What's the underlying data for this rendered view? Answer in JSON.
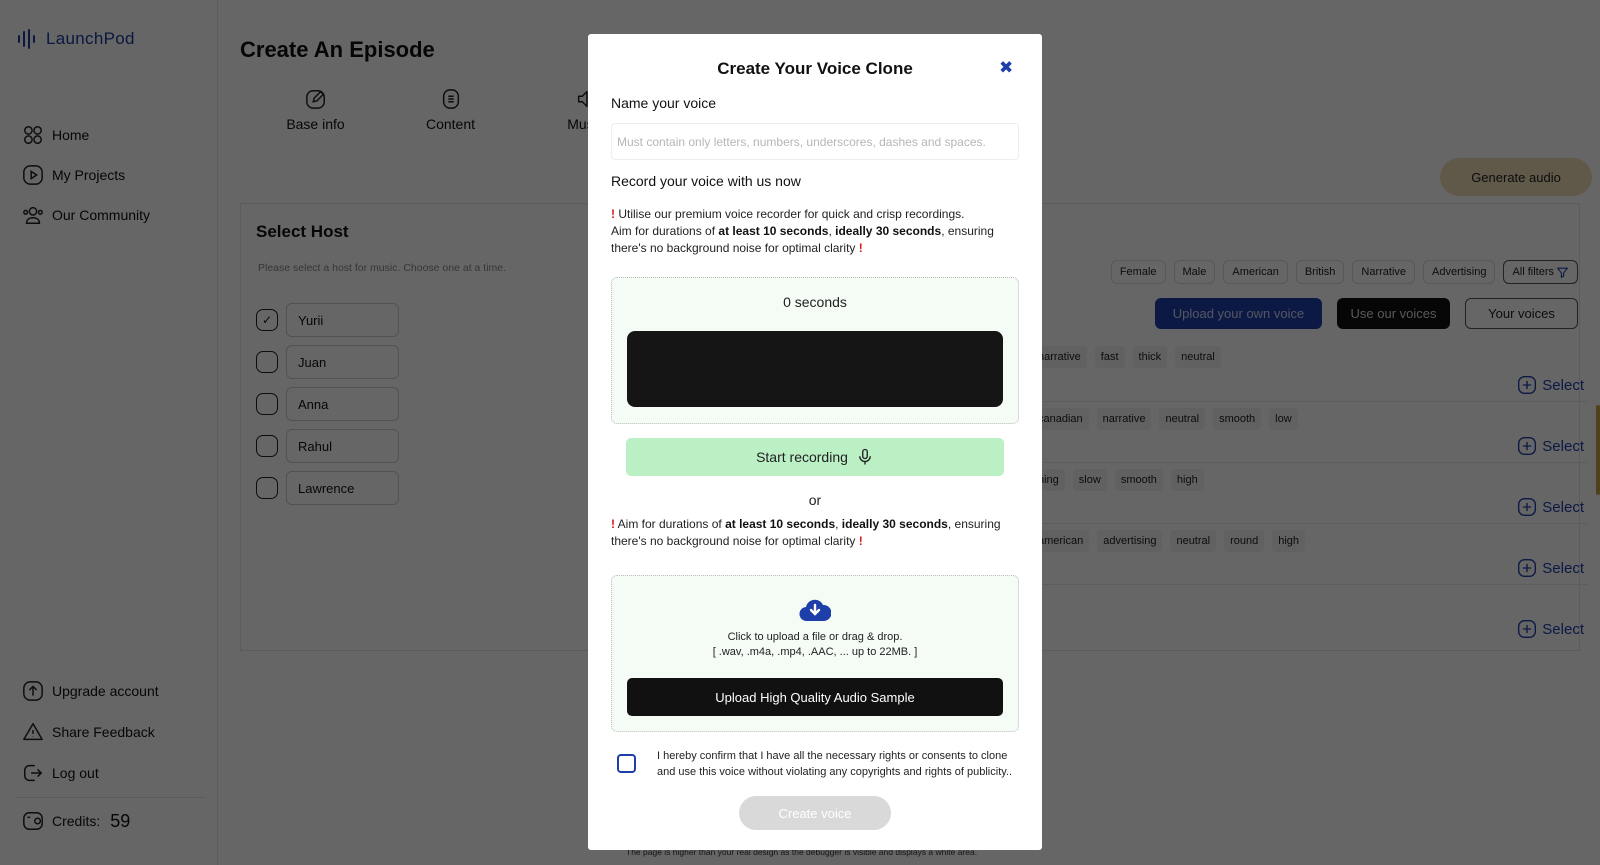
{
  "app": {
    "brand": "LaunchPod",
    "page_title": "Create An Episode"
  },
  "sidebar": {
    "top_items": [
      {
        "label": "Home",
        "icon": "grid-icon"
      },
      {
        "label": "My Projects",
        "icon": "play-icon"
      },
      {
        "label": "Our Community",
        "icon": "users-icon"
      }
    ],
    "bottom_items": [
      {
        "label": "Upgrade account",
        "icon": "upload-icon"
      },
      {
        "label": "Share Feedback",
        "icon": "warning-icon"
      },
      {
        "label": "Log out",
        "icon": "logout-icon"
      }
    ],
    "credits_label": "Credits:",
    "credits_value": "59"
  },
  "steps": [
    {
      "label": "Base info",
      "icon": "edit-icon"
    },
    {
      "label": "Content",
      "icon": "document-icon"
    },
    {
      "label": "Music",
      "icon": "speaker-icon"
    }
  ],
  "generate_label": "Generate audio",
  "host": {
    "title": "Select Host",
    "subtitle": "Please select a host for music. Choose one at a time.",
    "options": [
      {
        "name": "Yurii",
        "checked": true
      },
      {
        "name": "Juan",
        "checked": false
      },
      {
        "name": "Anna",
        "checked": false
      },
      {
        "name": "Rahul",
        "checked": false
      },
      {
        "name": "Lawrence",
        "checked": false
      }
    ]
  },
  "filters": [
    "Female",
    "Male",
    "American",
    "British",
    "Narrative",
    "Advertising",
    "All filters"
  ],
  "voice_tabs": [
    "Upload your own voice",
    "Use our voices",
    "Your voices"
  ],
  "voices": [
    {
      "tags": [
        "narrative",
        "fast",
        "thick",
        "neutral"
      ],
      "select": "Select"
    },
    {
      "tags": [
        "canadian",
        "narrative",
        "neutral",
        "smooth",
        "low"
      ],
      "select": "Select"
    },
    {
      "tags": [
        "ning",
        "slow",
        "smooth",
        "high"
      ],
      "select": "Select"
    },
    {
      "tags": [
        "american",
        "advertising",
        "neutral",
        "round",
        "high"
      ],
      "select": "Select"
    },
    {
      "tags": [],
      "select": "Select"
    }
  ],
  "footer_note": "The page is higher than your real design as the debugger is visible and displays a white area.",
  "modal": {
    "title": "Create Your Voice Clone",
    "close_icon": "close-icon",
    "name_label": "Name your voice",
    "name_placeholder": "Must contain only letters, numbers, underscores, dashes and spaces.",
    "name_value": "",
    "record_label": "Record your voice with us now",
    "record_note": {
      "line1": "Utilise our premium voice recorder for quick and crisp recordings.",
      "pre": "Aim for durations of ",
      "bold1": "at least 10 seconds",
      "sep": ", ",
      "bold2": "ideally 30 seconds",
      "post": ", ensuring there's no background noise for optimal clarity"
    },
    "timer": "0 seconds",
    "start_recording": "Start recording",
    "or": "or",
    "upload_note": {
      "pre": "Aim for durations of ",
      "bold1": "at least 10 seconds",
      "sep": ", ",
      "bold2": "ideally 30 seconds",
      "post": ", ensuring there's no background noise for optimal clarity"
    },
    "upload_hint": "Click to upload a file or drag & drop.",
    "upload_formats": "[ .wav, .m4a, .mp4, .AAC, ... up to 22MB. ]",
    "upload_button": "Upload High Quality Audio Sample",
    "consent": "I hereby confirm that I have all the necessary rights or consents to clone and use this voice without violating any copyrights and rights of publicity..",
    "consent_checked": false,
    "create_button": "Create voice",
    "bang": "!"
  },
  "colors": {
    "brand_blue": "#1e3faa",
    "record_green": "#bbf0c5",
    "warning_red": "#d81b1b",
    "generate_gold": "#f0dfb6"
  }
}
